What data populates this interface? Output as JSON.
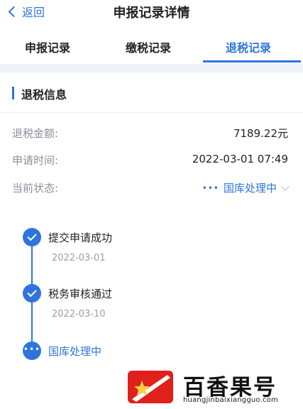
{
  "header": {
    "back_label": "返回",
    "title": "申报记录详情"
  },
  "tabs": [
    {
      "label": "申报记录",
      "active": false
    },
    {
      "label": "缴税记录",
      "active": false
    },
    {
      "label": "退税记录",
      "active": true
    }
  ],
  "section": {
    "title": "退税信息"
  },
  "info": {
    "amount_label": "退税金额:",
    "amount_value": "7189.22元",
    "time_label": "申请时间:",
    "time_value": "2022-03-01 07:49",
    "status_label": "当前状态:",
    "status_value": "国库处理中",
    "status_dots": "•••"
  },
  "timeline": [
    {
      "title": "提交申请成功",
      "date": "2022-03-01",
      "state": "done"
    },
    {
      "title": "税务审核通过",
      "date": "2022-03-10",
      "state": "done"
    },
    {
      "title": "国库处理中",
      "date": "",
      "state": "current"
    }
  ],
  "watermark": {
    "text": "百香果号",
    "url": "huangjinbaixiangguo.com"
  },
  "colors": {
    "accent": "#2f74dd",
    "muted": "#8a8f99",
    "watermark_red": "#e0201b"
  }
}
